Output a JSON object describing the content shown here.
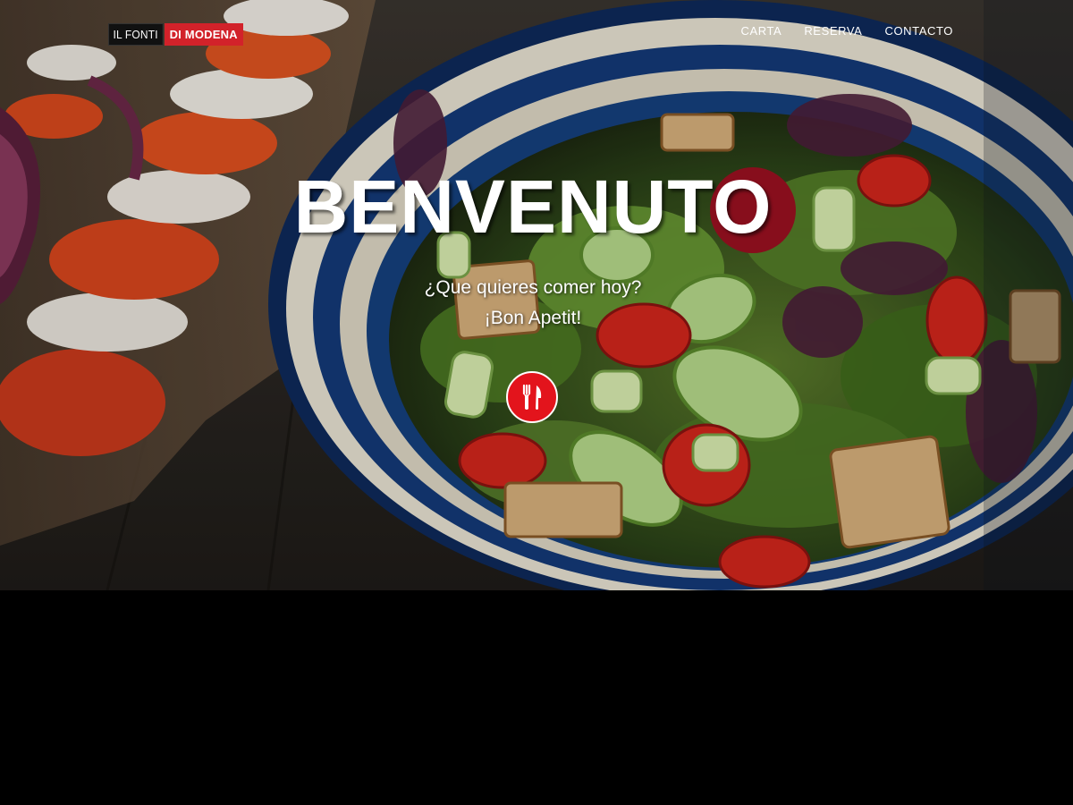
{
  "brand": {
    "logo_part1": "IL FONTI",
    "logo_part2": "DI MODENA",
    "accent_color": "#d2222a"
  },
  "nav": {
    "items": [
      {
        "label": "CARTA"
      },
      {
        "label": "RESERVA"
      },
      {
        "label": "CONTACTO"
      }
    ]
  },
  "hero": {
    "title": "BENVENUTO",
    "subtitle_line1": "¿Que quieres comer hoy?",
    "subtitle_line2": "¡Bon Apetit!",
    "cta_icon": "fork-knife-icon",
    "cta_color": "#e3141c"
  }
}
